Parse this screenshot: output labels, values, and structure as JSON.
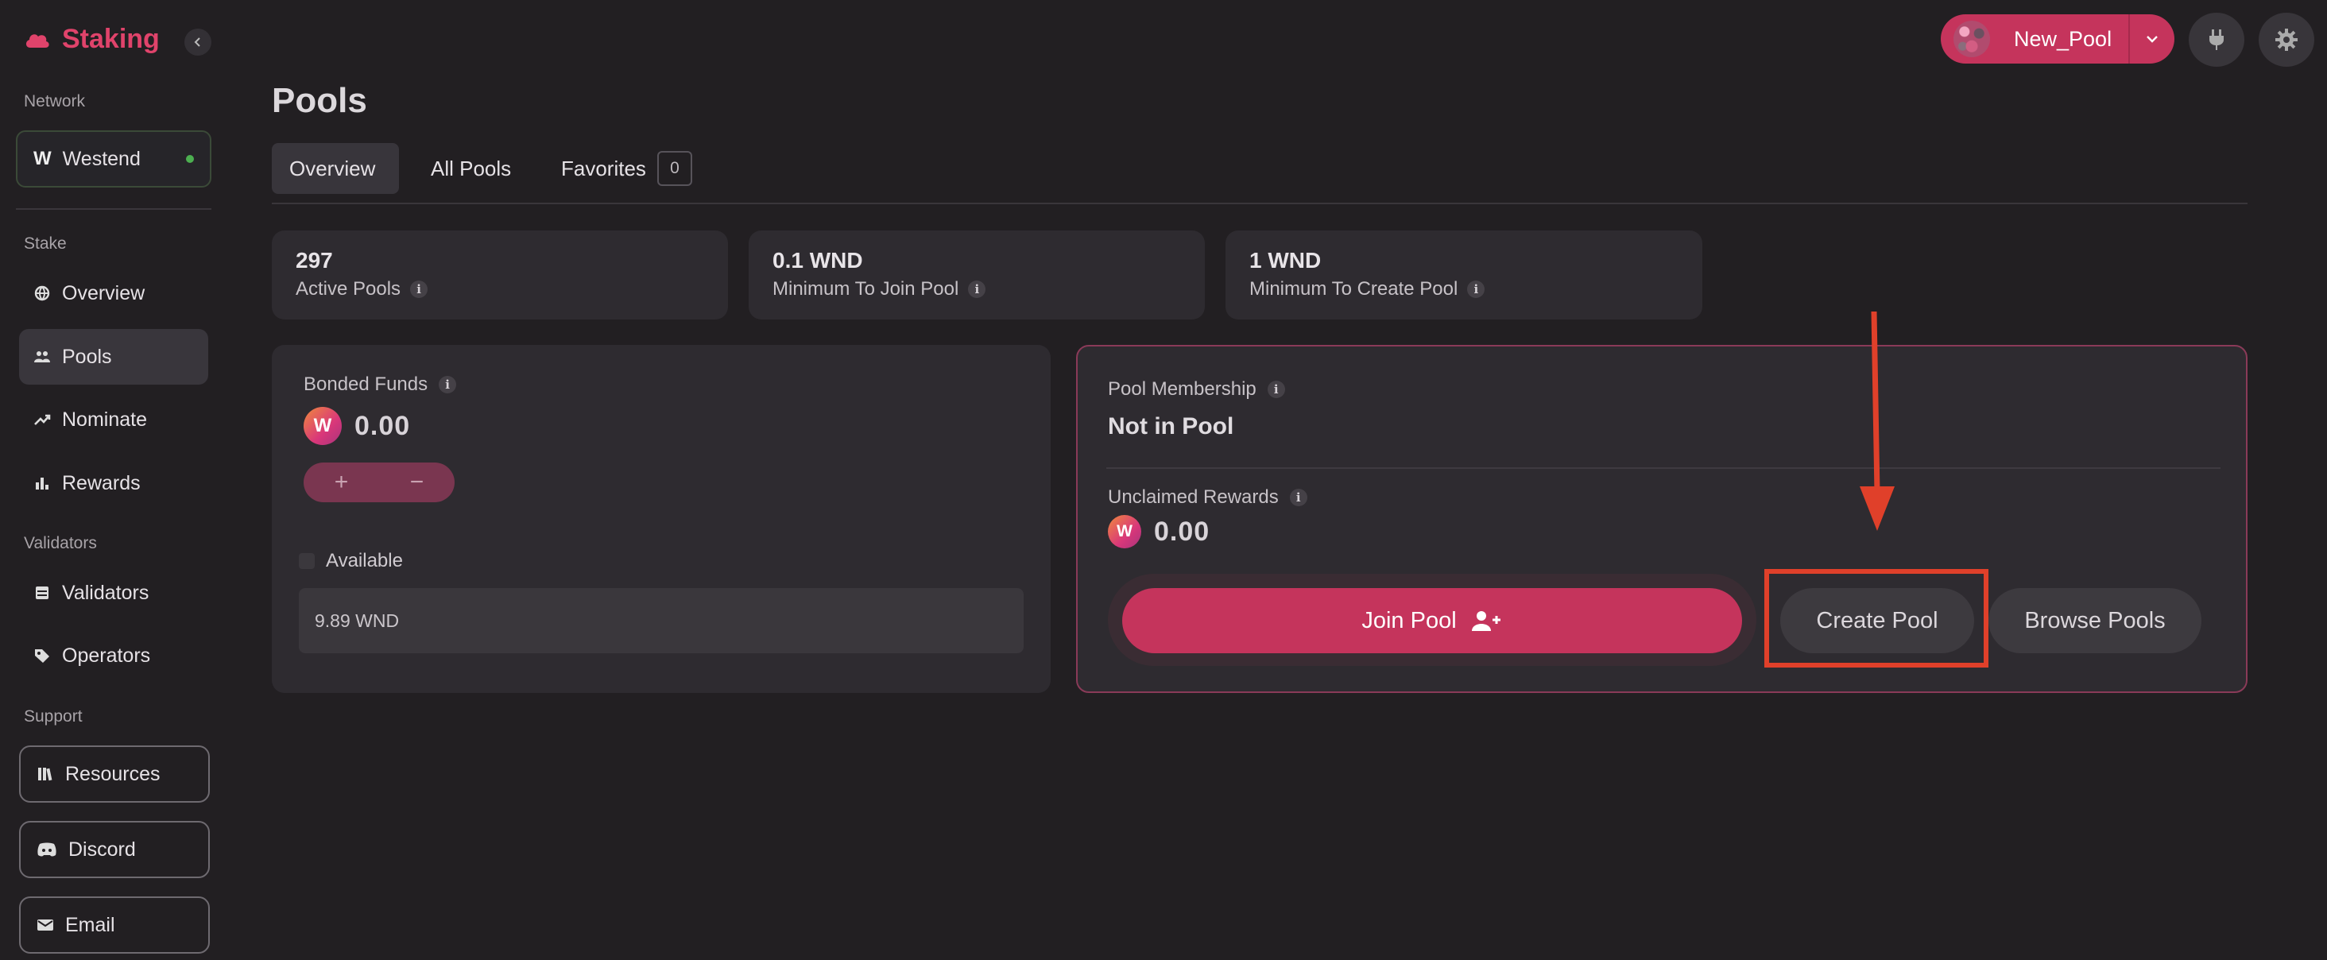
{
  "app": {
    "name": "Staking"
  },
  "sidebar": {
    "network_label": "Network",
    "network": {
      "badge": "W",
      "name": "Westend"
    },
    "stake_label": "Stake",
    "stake_items": [
      {
        "label": "Overview",
        "icon": "globe-icon"
      },
      {
        "label": "Pools",
        "icon": "users-icon"
      },
      {
        "label": "Nominate",
        "icon": "trend-icon"
      },
      {
        "label": "Rewards",
        "icon": "bar-chart-icon"
      }
    ],
    "validators_label": "Validators",
    "validators_items": [
      {
        "label": "Validators",
        "icon": "server-icon"
      },
      {
        "label": "Operators",
        "icon": "tag-icon"
      }
    ],
    "support_label": "Support",
    "support_items": [
      {
        "label": "Resources",
        "icon": "books-icon"
      },
      {
        "label": "Discord",
        "icon": "discord-icon"
      },
      {
        "label": "Email",
        "icon": "envelope-icon"
      }
    ]
  },
  "header": {
    "title": "Pools",
    "account_name": "New_Pool"
  },
  "tabs": [
    {
      "label": "Overview"
    },
    {
      "label": "All Pools"
    },
    {
      "label": "Favorites",
      "badge": "0"
    }
  ],
  "stats": [
    {
      "value": "297",
      "label": "Active Pools"
    },
    {
      "value": "0.1 WND",
      "label": "Minimum To Join Pool"
    },
    {
      "value": "1 WND",
      "label": "Minimum To Create Pool"
    }
  ],
  "bonded": {
    "label": "Bonded Funds",
    "token": "W",
    "amount": "0.00",
    "plus": "+",
    "minus": "−",
    "available_label": "Available",
    "available_value": "9.89 WND"
  },
  "membership": {
    "label": "Pool Membership",
    "status": "Not in Pool",
    "unclaimed_label": "Unclaimed Rewards",
    "token": "W",
    "unclaimed_amount": "0.00",
    "join_label": "Join Pool",
    "create_label": "Create Pool",
    "browse_label": "Browse Pools"
  },
  "colors": {
    "accent": "#c5345c",
    "annotation": "#e0402a",
    "background": "#221f22"
  }
}
